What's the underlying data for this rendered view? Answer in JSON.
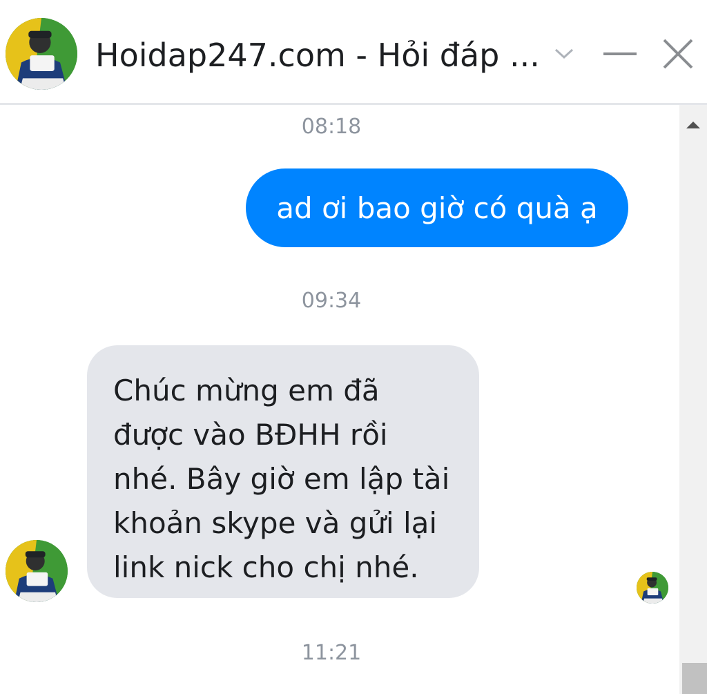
{
  "header": {
    "title": "Hoidap247.com - Hỏi đáp ...",
    "avatar_icon": "profile-avatar-icon",
    "chevron_icon": "chevron-down-icon",
    "minimize_icon": "minimize-icon",
    "close_icon": "close-icon"
  },
  "messages": {
    "timestamps": [
      "08:18",
      "09:34",
      "11:21"
    ],
    "outgoing": {
      "text": "ad ơi bao giờ có quà ạ",
      "color": "#0084ff"
    },
    "incoming": {
      "text": "Chúc mừng em đã\nđược vào BĐHH rồi\nnhé. Bây giờ em lập tài\nkhoản skype và gửi lại\nlink nick cho chị nhé.",
      "color": "#e4e6eb"
    }
  },
  "scrollbar": {
    "up_icon": "scroll-up-arrow-icon"
  }
}
